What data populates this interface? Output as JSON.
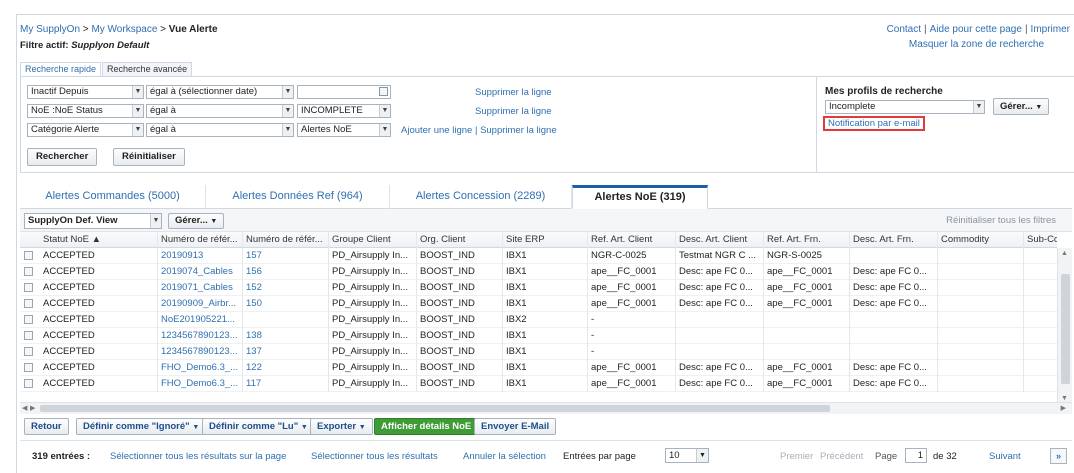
{
  "breadcrumb": {
    "item1": "My SupplyOn",
    "sep": " > ",
    "item2": "My Workspace",
    "current": "Vue Alerte"
  },
  "filtre": {
    "label": "Filtre actif:",
    "value": "Supplyon Default"
  },
  "toplinks": {
    "contact": "Contact",
    "aide": "Aide pour cette page",
    "imprimer": "Imprimer",
    "masquer": "Masquer la zone de recherche"
  },
  "search_tabs": [
    "Recherche rapide",
    "Recherche avancée"
  ],
  "search": {
    "rows": [
      {
        "field": "Inactif Depuis",
        "operator": "égal à (sélectionner date)",
        "value": "",
        "link": "Supprimer la ligne"
      },
      {
        "field": "NoE :NoE Status",
        "operator": "égal à",
        "value": "INCOMPLETE",
        "link": "Supprimer la ligne"
      },
      {
        "field": "Catégorie Alerte",
        "operator": "égal à",
        "value": "Alertes NoE",
        "link_add": "Ajouter une ligne",
        "link_sep": " | ",
        "link": "Supprimer la ligne"
      }
    ],
    "rechercher": "Rechercher",
    "reinitialiser": "Réinitialiser"
  },
  "profiles": {
    "title": "Mes profils de recherche",
    "selected": "Incomplete",
    "gerer": "Gérer...",
    "notification": "Notification par e-mail"
  },
  "tabs": [
    {
      "label": "Alertes Commandes (5000)"
    },
    {
      "label": "Alertes Données Ref (964)"
    },
    {
      "label": "Alertes Concession (2289)"
    },
    {
      "label": "Alertes NoE (319)"
    }
  ],
  "gridbar": {
    "view": "SupplyOn Def. View",
    "gerer": "Gérer...",
    "reinit": "Réinitialiser tous les filtres"
  },
  "columns": [
    "Statut NoE ▲",
    "Numéro de référ...",
    "Numéro de référ...",
    "Groupe Client",
    "Org. Client",
    "Site ERP",
    "Ref. Art. Client",
    "Desc. Art. Client",
    "Ref. Art. Frn.",
    "Desc. Art. Frn.",
    "Commodity",
    "Sub-Com"
  ],
  "rows": [
    [
      "ACCEPTED",
      "20190913",
      "157",
      "PD_Airsupply In...",
      "BOOST_IND",
      "IBX1",
      "NGR-C-0025",
      "Testmat NGR C ...",
      "NGR-S-0025",
      "",
      "",
      ""
    ],
    [
      "ACCEPTED",
      "2019074_Cables",
      "156",
      "PD_Airsupply In...",
      "BOOST_IND",
      "IBX1",
      "ape__FC_0001",
      "Desc: ape FC 0...",
      "ape__FC_0001",
      "Desc: ape FC 0...",
      "",
      ""
    ],
    [
      "ACCEPTED",
      "2019071_Cables",
      "152",
      "PD_Airsupply In...",
      "BOOST_IND",
      "IBX1",
      "ape__FC_0001",
      "Desc: ape FC 0...",
      "ape__FC_0001",
      "Desc: ape FC 0...",
      "",
      ""
    ],
    [
      "ACCEPTED",
      "20190909_Airbr...",
      "150",
      "PD_Airsupply In...",
      "BOOST_IND",
      "IBX1",
      "ape__FC_0001",
      "Desc: ape FC 0...",
      "ape__FC_0001",
      "Desc: ape FC 0...",
      "",
      ""
    ],
    [
      "ACCEPTED",
      "NoE201905221...",
      "",
      "PD_Airsupply In...",
      "BOOST_IND",
      "IBX2",
      "-",
      "",
      "",
      "",
      "",
      ""
    ],
    [
      "ACCEPTED",
      "1234567890123...",
      "138",
      "PD_Airsupply In...",
      "BOOST_IND",
      "IBX1",
      "-",
      "",
      "",
      "",
      "",
      ""
    ],
    [
      "ACCEPTED",
      "1234567890123...",
      "137",
      "PD_Airsupply In...",
      "BOOST_IND",
      "IBX1",
      "-",
      "",
      "",
      "",
      "",
      ""
    ],
    [
      "ACCEPTED",
      "FHO_Demo6.3_...",
      "122",
      "PD_Airsupply In...",
      "BOOST_IND",
      "IBX1",
      "ape__FC_0001",
      "Desc: ape FC 0...",
      "ape__FC_0001",
      "Desc: ape FC 0...",
      "",
      ""
    ],
    [
      "ACCEPTED",
      "FHO_Demo6.3_...",
      "117",
      "PD_Airsupply In...",
      "BOOST_IND",
      "IBX1",
      "ape__FC_0001",
      "Desc: ape FC 0...",
      "ape__FC_0001",
      "Desc: ape FC 0...",
      "",
      ""
    ]
  ],
  "actions": {
    "retour": "Retour",
    "ignore": "Définir comme \"Ignoré\"",
    "lu": "Définir comme \"Lu\"",
    "exporter": "Exporter",
    "afficher": "Afficher détails NoE",
    "envoyer": "Envoyer E-Mail"
  },
  "pager": {
    "count": "319 entrées :",
    "sel_page": "Sélectionner tous les résultats sur la page",
    "sel_all": "Sélectionner tous les résultats",
    "annuler": "Annuler la sélection",
    "per_page_label": "Entrées par page",
    "per_page": "10",
    "premier": "Premier",
    "precedent": "Précédent",
    "page_label": "Page",
    "page": "1",
    "of": "de 32",
    "suivant": "Suivant",
    "last": "»"
  },
  "colors": {
    "link": "#2f6fb0",
    "accent_tab": "#1d5da8",
    "green_button": "#3f9b35",
    "notification_border": "#e23a3a"
  }
}
